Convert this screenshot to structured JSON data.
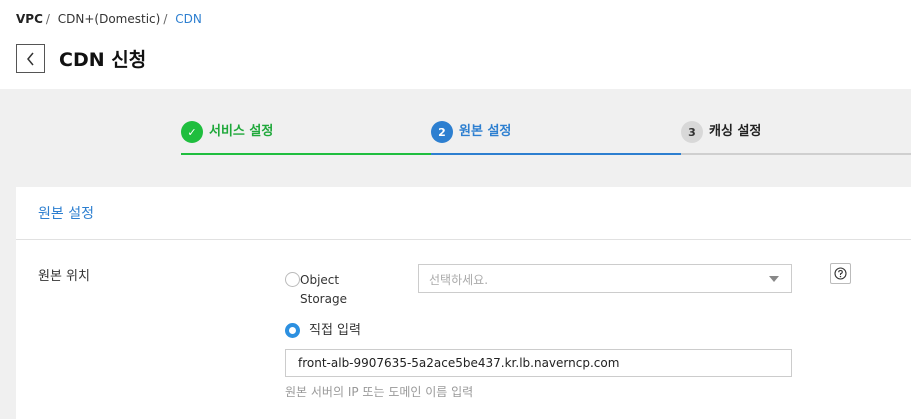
{
  "breadcrumb": {
    "items": [
      "VPC",
      "CDN+(Domestic)",
      "CDN"
    ],
    "separator": "/"
  },
  "header": {
    "title": "CDN 신청",
    "back_icon": "chevron-left-icon"
  },
  "steps": [
    {
      "badge": "✓",
      "label": "서비스 설정",
      "state": "completed",
      "color": "#1fbe3e"
    },
    {
      "badge": "2",
      "label": "원본 설정",
      "state": "active",
      "color": "#2d7fd0"
    },
    {
      "badge": "3",
      "label": "캐싱 설정",
      "state": "pending",
      "color": "#d8d8d8"
    }
  ],
  "panel": {
    "title": "원본 설정",
    "field_label": "원본 위치",
    "options": [
      {
        "label_line1": "Object",
        "label_line2": "Storage",
        "checked": false
      },
      {
        "label": "직접 입력",
        "checked": true
      }
    ],
    "select": {
      "placeholder": "선택하세요."
    },
    "help_icon": "question-circle-icon",
    "input": {
      "value": "front-alb-9907635-5a2ace5be437.kr.lb.naverncp.com"
    },
    "hint": "원본 서버의 IP 또는 도메인 이름 입력"
  },
  "colors": {
    "accent": "#2d7fd0",
    "success": "#1fbe3e",
    "background": "#f0f0f0"
  }
}
